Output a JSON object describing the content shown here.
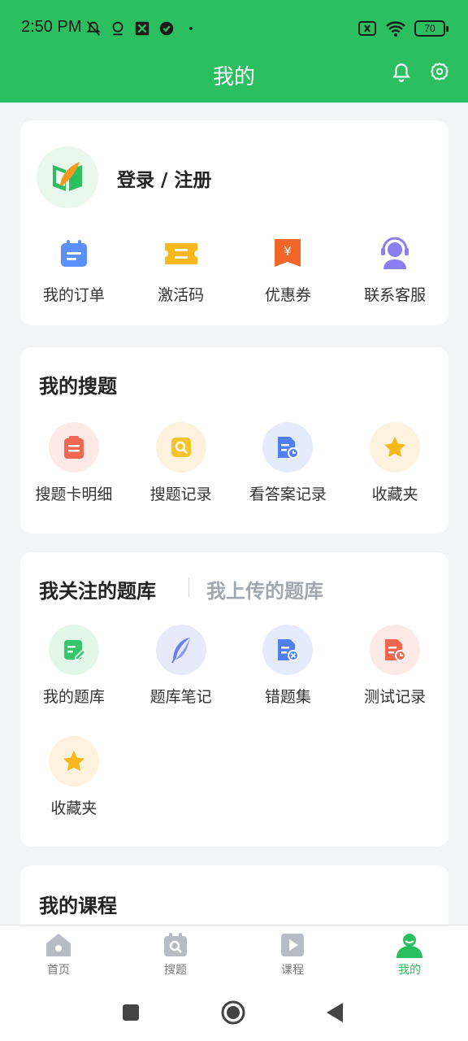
{
  "status": {
    "time": "2:50 PM",
    "battery": "70"
  },
  "header": {
    "title": "我的",
    "bell_icon": "bell-icon",
    "settings_icon": "gear-icon"
  },
  "profile": {
    "login_label": "登录 / 注册"
  },
  "quick_actions": [
    {
      "label": "我的订单",
      "icon": "calendar-order-icon",
      "color": "#5b8ff9"
    },
    {
      "label": "激活码",
      "icon": "ticket-icon",
      "color": "#f6b81c"
    },
    {
      "label": "优惠券",
      "icon": "coupon-icon",
      "color": "#f3662a"
    },
    {
      "label": "联系客服",
      "icon": "customer-service-icon",
      "color": "#8a7ff0"
    }
  ],
  "my_search": {
    "title": "我的搜题",
    "items": [
      {
        "label": "搜题卡明细",
        "icon": "card-detail-icon"
      },
      {
        "label": "搜题记录",
        "icon": "search-record-icon"
      },
      {
        "label": "看答案记录",
        "icon": "answer-record-icon"
      },
      {
        "label": "收藏夹",
        "icon": "star-icon"
      }
    ]
  },
  "question_bank": {
    "tab_active": "我关注的题库",
    "tab_inactive": "我上传的题库",
    "items": [
      {
        "label": "我的题库",
        "icon": "edit-bank-icon"
      },
      {
        "label": "题库笔记",
        "icon": "feather-icon"
      },
      {
        "label": "错题集",
        "icon": "wrong-set-icon"
      },
      {
        "label": "测试记录",
        "icon": "test-record-icon"
      },
      {
        "label": "收藏夹",
        "icon": "star-icon"
      }
    ]
  },
  "my_courses": {
    "title": "我的课程"
  },
  "bottom_nav": [
    {
      "label": "首页",
      "icon": "home-icon"
    },
    {
      "label": "搜题",
      "icon": "search-tab-icon"
    },
    {
      "label": "课程",
      "icon": "play-icon"
    },
    {
      "label": "我的",
      "icon": "user-icon",
      "active": true
    }
  ],
  "colors": {
    "brand_green": "#2cbf5f",
    "background": "#f3f4f6",
    "inactive_tab": "#a0a7b0"
  }
}
